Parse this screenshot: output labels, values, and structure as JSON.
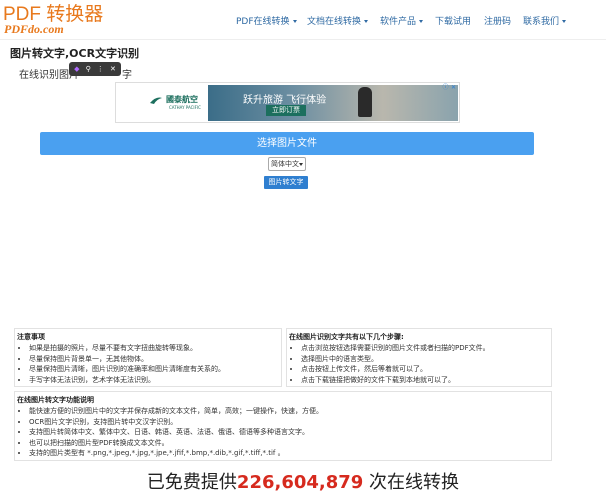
{
  "logo": {
    "main": "PDF 转换器",
    "sub": "PDFdo.com"
  },
  "nav": [
    {
      "label": "PDF在线转换",
      "dropdown": true
    },
    {
      "label": "文档在线转换",
      "dropdown": true
    },
    {
      "label": "软件产品",
      "dropdown": true
    },
    {
      "label": "下载试用",
      "dropdown": false
    },
    {
      "label": "注册码",
      "dropdown": false
    },
    {
      "label": "联系我们",
      "dropdown": true
    }
  ],
  "page": {
    "title": "图片转文字,OCR文字识别",
    "desc_start": "在线识别图片",
    "desc_end": "字"
  },
  "mini_toolbar": {
    "icons": [
      "app-icon",
      "search-icon",
      "more-icon",
      "close-icon"
    ]
  },
  "ad": {
    "brand": "國泰航空",
    "brand_sub": "CATHAY PACIFIC",
    "headline": "跃升旅游 飞行体验",
    "cta": "立即订票"
  },
  "choose_button": "选择图片文件",
  "language_select": {
    "selected": "简体中文"
  },
  "convert_button": "图片转文字",
  "notes": {
    "title": "注意事项",
    "items": [
      "如果是拍摄的照片，尽量不要有文字扭曲旋转等现象。",
      "尽量保持图片背景单一，无其他物体。",
      "尽量保持图片清晰，图片识别的准确率和图片清晰度有关系的。",
      "手写字体无法识别，艺术字体无法识别。"
    ]
  },
  "steps": {
    "title": "在线图片识别文字共有以下几个步骤:",
    "items": [
      "点击浏览按钮选择需要识别的图片文件或者扫描的PDF文件。",
      "选择图片中的语言类型。",
      "点击按钮上传文件，然后等着就可以了。",
      "点击下载链接把做好的文件下载到本地就可以了。"
    ]
  },
  "features": {
    "title": "在线图片转文字功能说明",
    "items": [
      "能快速方便的识别图片中的文字并保存成新的文本文件，简单，高效；一键操作，快速，方便。",
      "OCR图片文字识别，支持图片转中文汉字识别。",
      "支持图片转简体中文、繁体中文、日语、韩语、英语、法语、俄语、德语等多种语言文字。",
      "也可以把扫描的图片型PDF转换成文本文件。",
      "支持的图片类型有 *.png,*.jpeg,*.jpg,*.jpe,*.jfif,*.bmp,*.dib,*.gif,*.tiff,*.tif 。"
    ]
  },
  "counter": {
    "prefix": "已免费提供",
    "number": "226,604,879",
    "suffix": " 次在线转换"
  },
  "colors": {
    "brand_orange": "#e8791d",
    "nav_blue": "#2f6aa3",
    "button_blue": "#4aa0f0",
    "counter_red": "#d62a1e"
  }
}
